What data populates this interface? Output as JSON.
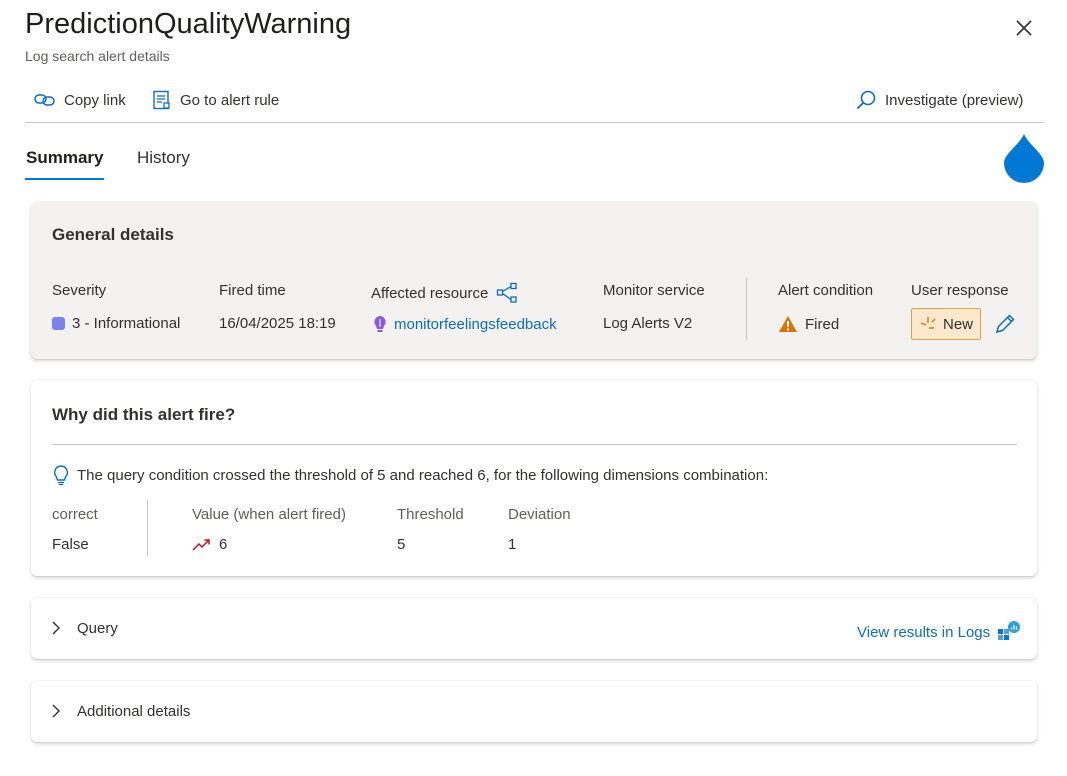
{
  "header": {
    "title": "PredictionQualityWarning",
    "subtitle": "Log search alert details"
  },
  "toolbar": {
    "copy_link": "Copy link",
    "go_to_alert_rule": "Go to alert rule",
    "investigate": "Investigate (preview)"
  },
  "tabs": [
    {
      "label": "Summary",
      "active": true
    },
    {
      "label": "History",
      "active": false
    }
  ],
  "general": {
    "heading": "General details",
    "severity_label": "Severity",
    "severity_value": "3 - Informational",
    "severity_color": "#7b83eb",
    "fired_time_label": "Fired time",
    "fired_time_value": "16/04/2025 18:19",
    "affected_resource_label": "Affected resource",
    "affected_resource_value": "monitorfeelingsfeedback",
    "monitor_service_label": "Monitor service",
    "monitor_service_value": "Log Alerts V2",
    "alert_condition_label": "Alert condition",
    "alert_condition_value": "Fired",
    "user_response_label": "User response",
    "user_response_value": "New"
  },
  "why": {
    "heading": "Why did this alert fire?",
    "message": "The query condition crossed the threshold of 5 and reached 6, for the following dimensions combination:",
    "dimension_header": "correct",
    "dimension_value": "False",
    "columns": [
      "Value (when alert fired)",
      "Threshold",
      "Deviation"
    ],
    "values": [
      "6",
      "5",
      "1"
    ]
  },
  "query": {
    "label": "Query",
    "view_results": "View results in Logs"
  },
  "additional": {
    "label": "Additional details"
  },
  "colors": {
    "accent": "#0078d4",
    "link": "#0f6cbd",
    "warning": "#d67500",
    "new_badge_bg": "#fde7cd",
    "new_badge_border": "#e3a24d"
  }
}
